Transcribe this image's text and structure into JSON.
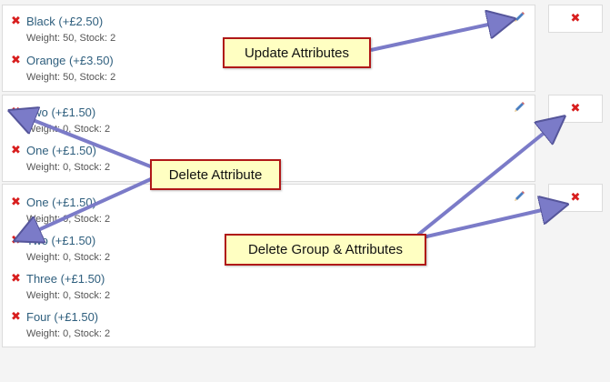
{
  "groups": [
    {
      "attributes": [
        {
          "label": "Black (+£2.50)",
          "meta": "Weight: 50, Stock: 2"
        },
        {
          "label": "Orange (+£3.50)",
          "meta": "Weight: 50, Stock: 2"
        }
      ]
    },
    {
      "attributes": [
        {
          "label": "Two (+£1.50)",
          "meta": "Weight: 0, Stock: 2"
        },
        {
          "label": "One (+£1.50)",
          "meta": "Weight: 0, Stock: 2"
        }
      ]
    },
    {
      "attributes": [
        {
          "label": "One (+£1.50)",
          "meta": "Weight: 0, Stock: 2"
        },
        {
          "label": "Two (+£1.50)",
          "meta": "Weight: 0, Stock: 2"
        },
        {
          "label": "Three (+£1.50)",
          "meta": "Weight: 0, Stock: 2"
        },
        {
          "label": "Four (+£1.50)",
          "meta": "Weight: 0, Stock: 2"
        }
      ]
    }
  ],
  "icons": {
    "delete": "✖",
    "delete_icon_name": "delete-x-icon",
    "edit_icon_name": "pencil-icon"
  },
  "callouts": {
    "update": "Update Attributes",
    "delete_attribute": "Delete Attribute",
    "delete_group": "Delete Group & Attributes"
  },
  "colors": {
    "delete_red": "#d81e1e",
    "link_blue": "#2f5f7e",
    "callout_fill": "#ffffc2",
    "callout_border": "#b01818",
    "arrow": "#7b7bc8"
  }
}
